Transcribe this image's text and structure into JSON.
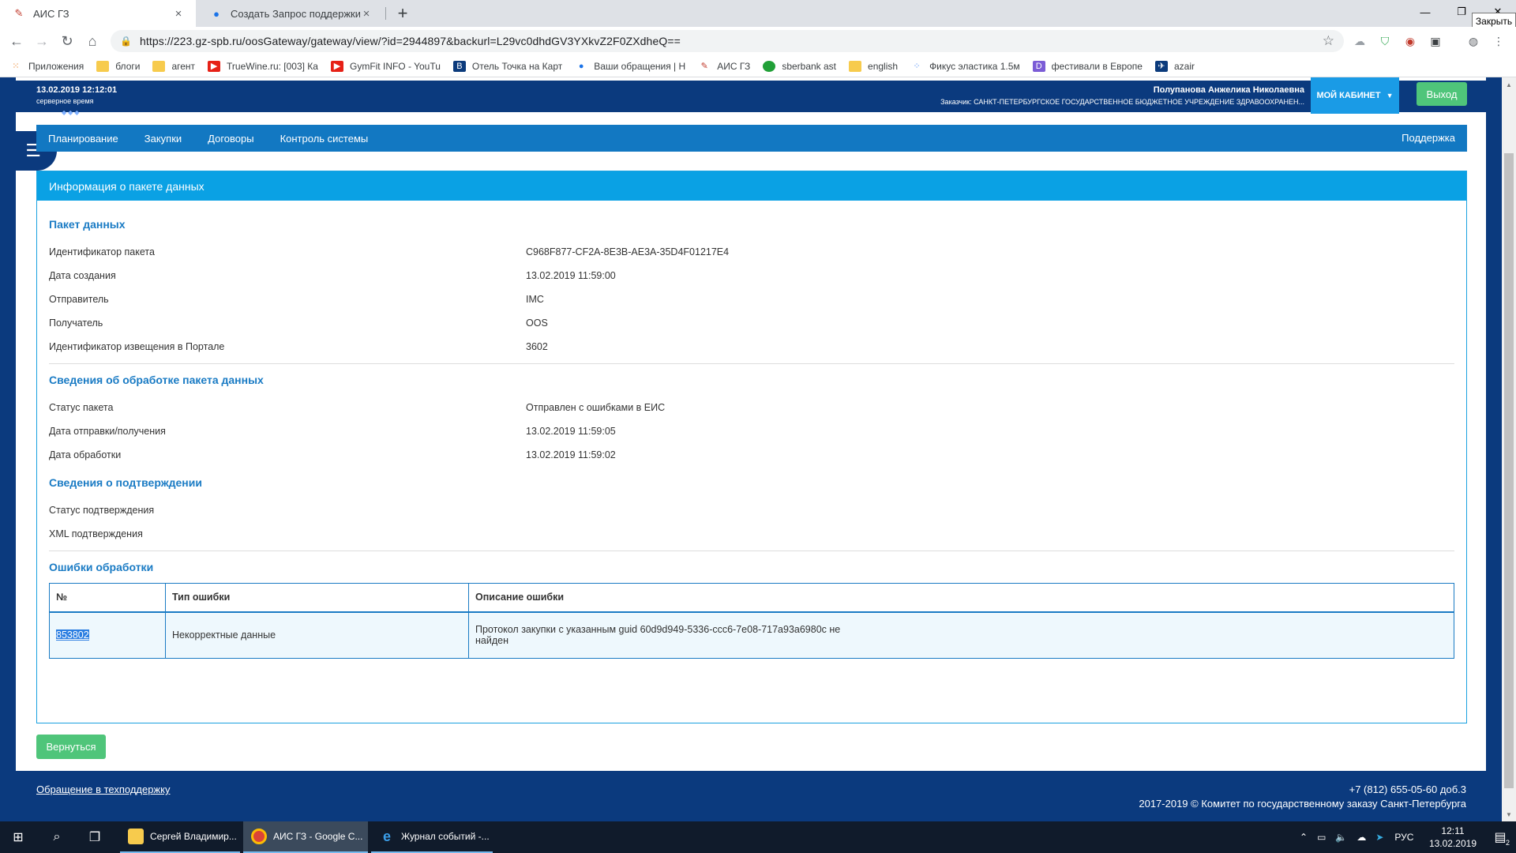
{
  "browser": {
    "tabs": [
      {
        "title": "АИС ГЗ",
        "active": true
      },
      {
        "title": "Создать Запрос поддержки - П",
        "active": false
      }
    ],
    "new_tab_icon": "plus-icon",
    "url": "https://223.gz-spb.ru/oosGateway/gateway/view/?id=2944897&backurl=L29vc0dhdGV3YXkvZ2F0ZXdheQ==",
    "tooltip": "Закрыть",
    "bookmarks": [
      {
        "label": "Приложения"
      },
      {
        "label": "блоги"
      },
      {
        "label": "агент"
      },
      {
        "label": "TrueWine.ru: [003] Ка"
      },
      {
        "label": "GymFit INFO - YouTu"
      },
      {
        "label": "Отель Точка на Карт"
      },
      {
        "label": "Ваши обращения | Н"
      },
      {
        "label": "АИС ГЗ"
      },
      {
        "label": "sberbank ast"
      },
      {
        "label": "english"
      },
      {
        "label": "Фикус эластика 1.5м"
      },
      {
        "label": "фестивали в Европе"
      },
      {
        "label": "azair"
      }
    ]
  },
  "header": {
    "server_time": "13.02.2019 12:12:01",
    "server_time_label": "серверное время",
    "user_name": "Полупанова Анжелика Николаевна",
    "customer": "Заказчик: САНКТ-ПЕТЕРБУРГСКОЕ ГОСУДАРСТВЕННОЕ БЮДЖЕТНОЕ УЧРЕЖДЕНИЕ ЗДРАВООХРАНЕН...",
    "cabinet_label": "МОЙ КАБИНЕТ",
    "exit_label": "Выход"
  },
  "nav": {
    "items": [
      {
        "label": "Планирование"
      },
      {
        "label": "Закупки"
      },
      {
        "label": "Договоры"
      },
      {
        "label": "Контроль системы"
      }
    ],
    "support": "Поддержка"
  },
  "panel": {
    "title": "Информация о пакете данных",
    "sections": [
      {
        "title": "Пакет данных",
        "rows": [
          {
            "label": "Идентификатор пакета",
            "value": "C968F877-CF2A-8E3B-AE3A-35D4F01217E4"
          },
          {
            "label": "Дата создания",
            "value": "13.02.2019 11:59:00"
          },
          {
            "label": "Отправитель",
            "value": "IMC"
          },
          {
            "label": "Получатель",
            "value": "OOS"
          },
          {
            "label": "Идентификатор извещения в Портале",
            "value": "3602"
          }
        ]
      },
      {
        "title": "Сведения об обработке пакета данных",
        "rows": [
          {
            "label": "Статус пакета",
            "value": "Отправлен с ошибками в ЕИС"
          },
          {
            "label": "Дата отправки/получения",
            "value": "13.02.2019 11:59:05"
          },
          {
            "label": "Дата обработки",
            "value": "13.02.2019 11:59:02"
          }
        ]
      },
      {
        "title": "Сведения о подтверждении",
        "rows": [
          {
            "label": "Статус подтверждения",
            "value": ""
          },
          {
            "label": "XML подтверждения",
            "value": ""
          }
        ]
      }
    ],
    "errors": {
      "title": "Ошибки обработки",
      "columns": [
        "№",
        "Тип ошибки",
        "Описание ошибки"
      ],
      "rows": [
        {
          "num": "853802",
          "type": "Некорректные данные",
          "desc_line1": "Протокол закупки с указанным guid 60d9d949-5336-ccc6-7e08-717a93a6980c не",
          "desc_line2": "найден"
        }
      ]
    }
  },
  "back_label": "Вернуться",
  "footer": {
    "link": "Обращение в техподдержку",
    "phone": "+7 (812) 655-05-60 доб.3",
    "copyright": "2017-2019 © Комитет по государственному заказу Санкт-Петербурга"
  },
  "taskbar": {
    "apps": [
      {
        "label": "Сергей Владимир..."
      },
      {
        "label": "АИС ГЗ - Google C..."
      },
      {
        "label": "Журнал событий -..."
      }
    ],
    "lang": "РУС",
    "time": "12:11",
    "date": "13.02.2019",
    "notifications": "2"
  },
  "colors": {
    "brand_dark": "#0b3a7e",
    "nav_blue": "#1278c2",
    "panel_head": "#0aa1e4",
    "accent_green": "#4fc57a",
    "section_title": "#1a7bc4"
  }
}
